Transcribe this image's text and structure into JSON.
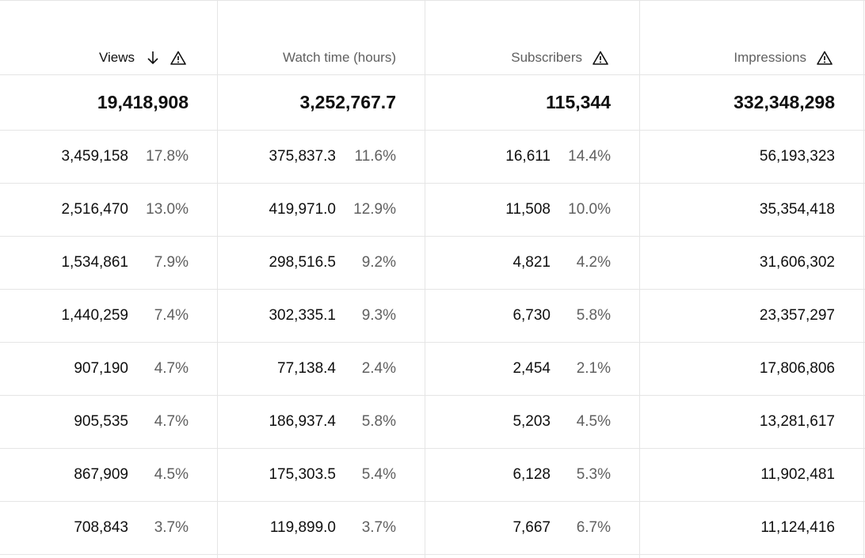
{
  "columns": [
    {
      "label": "Views",
      "sorted": true,
      "sort_icon": "arrow-down-icon",
      "warning_icon": true
    },
    {
      "label": "Watch time (hours)",
      "sorted": false,
      "warning_icon": false
    },
    {
      "label": "Subscribers",
      "sorted": false,
      "warning_icon": true
    },
    {
      "label": "Impressions",
      "sorted": false,
      "warning_icon": true
    }
  ],
  "totals": [
    "19,418,908",
    "3,252,767.7",
    "115,344",
    "332,348,298"
  ],
  "rows": [
    {
      "views": "3,459,158",
      "views_pct": "17.8%",
      "watch": "375,837.3",
      "watch_pct": "11.6%",
      "subs": "16,611",
      "subs_pct": "14.4%",
      "impressions": "56,193,323"
    },
    {
      "views": "2,516,470",
      "views_pct": "13.0%",
      "watch": "419,971.0",
      "watch_pct": "12.9%",
      "subs": "11,508",
      "subs_pct": "10.0%",
      "impressions": "35,354,418"
    },
    {
      "views": "1,534,861",
      "views_pct": "7.9%",
      "watch": "298,516.5",
      "watch_pct": "9.2%",
      "subs": "4,821",
      "subs_pct": "4.2%",
      "impressions": "31,606,302"
    },
    {
      "views": "1,440,259",
      "views_pct": "7.4%",
      "watch": "302,335.1",
      "watch_pct": "9.3%",
      "subs": "6,730",
      "subs_pct": "5.8%",
      "impressions": "23,357,297"
    },
    {
      "views": "907,190",
      "views_pct": "4.7%",
      "watch": "77,138.4",
      "watch_pct": "2.4%",
      "subs": "2,454",
      "subs_pct": "2.1%",
      "impressions": "17,806,806"
    },
    {
      "views": "905,535",
      "views_pct": "4.7%",
      "watch": "186,937.4",
      "watch_pct": "5.8%",
      "subs": "5,203",
      "subs_pct": "4.5%",
      "impressions": "13,281,617"
    },
    {
      "views": "867,909",
      "views_pct": "4.5%",
      "watch": "175,303.5",
      "watch_pct": "5.4%",
      "subs": "6,128",
      "subs_pct": "5.3%",
      "impressions": "11,902,481"
    },
    {
      "views": "708,843",
      "views_pct": "3.7%",
      "watch": "119,899.0",
      "watch_pct": "3.7%",
      "subs": "7,667",
      "subs_pct": "6.7%",
      "impressions": "11,124,416"
    }
  ],
  "colors": {
    "text": "#0f0f0f",
    "secondary_text": "#606060",
    "divider": "#e5e5e5"
  }
}
